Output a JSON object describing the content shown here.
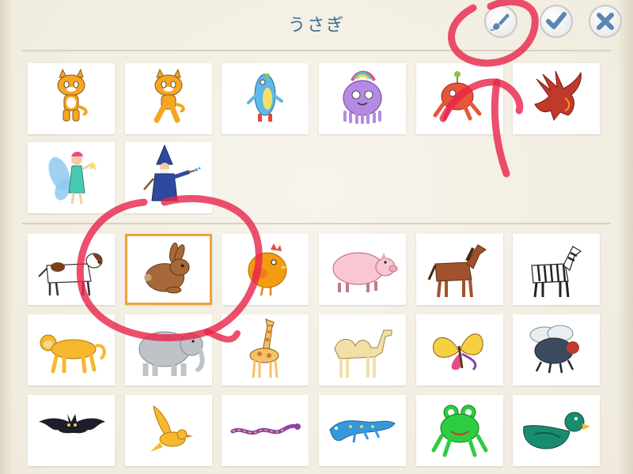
{
  "header": {
    "title": "うさぎ",
    "buttons": [
      {
        "icon": "paintbrush-icon"
      },
      {
        "icon": "checkmark-icon"
      },
      {
        "icon": "close-icon"
      }
    ]
  },
  "colors": {
    "title": "#3e6b8c",
    "button_icon": "#5a86b4",
    "selected_border": "#f0a33a",
    "annotation_ink": "#e8234a"
  },
  "characters_section": {
    "items": [
      {
        "icon": "scratch-cat-icon"
      },
      {
        "icon": "scratch-cat-walking-icon"
      },
      {
        "icon": "blue-fish-creature-icon"
      },
      {
        "icon": "purple-monster-icon"
      },
      {
        "icon": "red-alien-icon"
      },
      {
        "icon": "red-dragon-icon"
      },
      {
        "icon": "fairy-icon"
      },
      {
        "icon": "wizard-icon"
      }
    ]
  },
  "animals_section": {
    "selected": "rabbit-icon",
    "items": [
      {
        "icon": "dog-icon"
      },
      {
        "icon": "rabbit-icon"
      },
      {
        "icon": "chicken-icon"
      },
      {
        "icon": "pig-icon"
      },
      {
        "icon": "horse-icon"
      },
      {
        "icon": "zebra-icon"
      },
      {
        "icon": "monkey-icon"
      },
      {
        "icon": "elephant-icon"
      },
      {
        "icon": "giraffe-icon"
      },
      {
        "icon": "camel-icon"
      },
      {
        "icon": "butterfly-icon"
      },
      {
        "icon": "fly-icon"
      },
      {
        "icon": "bat-icon"
      },
      {
        "icon": "bird-icon"
      },
      {
        "icon": "snake-icon"
      },
      {
        "icon": "lizard-icon"
      },
      {
        "icon": "frog-icon"
      },
      {
        "icon": "duck-icon"
      }
    ]
  }
}
